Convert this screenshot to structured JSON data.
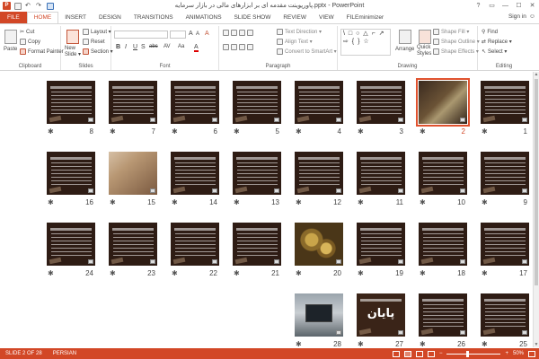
{
  "app": {
    "title": "پاورپوینت مقدمه ای بر ابزارهای مالی در بازار سرمایه.pptx - PowerPoint",
    "logo_letter": "P",
    "accent_color": "#d24726",
    "sign_in": "Sign in",
    "window_controls": [
      "?",
      "▭",
      "—",
      "☐",
      "✕"
    ]
  },
  "tabs": [
    {
      "label": "FILE",
      "key": "file"
    },
    {
      "label": "HOME",
      "key": "home",
      "active": true
    },
    {
      "label": "INSERT",
      "key": "insert"
    },
    {
      "label": "DESIGN",
      "key": "design"
    },
    {
      "label": "TRANSITIONS",
      "key": "transitions"
    },
    {
      "label": "ANIMATIONS",
      "key": "animations"
    },
    {
      "label": "SLIDE SHOW",
      "key": "slideshow"
    },
    {
      "label": "REVIEW",
      "key": "review"
    },
    {
      "label": "VIEW",
      "key": "view"
    },
    {
      "label": "FILEminimizer",
      "key": "fileminimizer"
    }
  ],
  "ribbon": {
    "clipboard": {
      "label": "Clipboard",
      "paste": "Paste",
      "cut": "Cut",
      "copy": "Copy",
      "format_painter": "Format Painter"
    },
    "slides": {
      "label": "Slides",
      "new_slide": "New",
      "new_slide_2": "Slide ▾",
      "layout": "Layout ▾",
      "reset": "Reset",
      "section": "Section ▾"
    },
    "font": {
      "label": "Font",
      "size_up": "A",
      "size_down": "A",
      "clear": "A",
      "bold": "B",
      "italic": "I",
      "underline": "U",
      "strike": "S",
      "shadow": "abc",
      "spacing": "AV",
      "case": "Aa",
      "color": "A"
    },
    "paragraph": {
      "label": "Paragraph",
      "text_direction": "Text Direction ▾",
      "align_text": "Align Text ▾",
      "smartart": "Convert to SmartArt ▾"
    },
    "drawing": {
      "label": "Drawing",
      "shapes": "\\ □ ○ △ ⌐ ↗ ⇨ { } ☆",
      "arrange": "Arrange",
      "quick_styles_1": "Quick",
      "quick_styles_2": "Styles ▾",
      "shape_fill": "Shape Fill ▾",
      "shape_outline": "Shape Outline ▾",
      "shape_effects": "Shape Effects ▾"
    },
    "editing": {
      "label": "Editing",
      "find": "Find",
      "replace": "Replace ▾",
      "select": "Select ▾"
    }
  },
  "slides": [
    {
      "num": "1",
      "style": "text",
      "star": "✱"
    },
    {
      "num": "2",
      "style": "money",
      "selected": true,
      "star": "✱"
    },
    {
      "num": "3",
      "style": "text",
      "star": "✱"
    },
    {
      "num": "4",
      "style": "text",
      "star": "✱"
    },
    {
      "num": "5",
      "style": "text",
      "star": "✱"
    },
    {
      "num": "6",
      "style": "text",
      "star": "✱"
    },
    {
      "num": "7",
      "style": "text",
      "star": "✱"
    },
    {
      "num": "8",
      "style": "text",
      "star": "✱"
    },
    {
      "num": "9",
      "style": "text",
      "star": "✱"
    },
    {
      "num": "10",
      "style": "text",
      "star": "✱"
    },
    {
      "num": "11",
      "style": "text",
      "star": "✱"
    },
    {
      "num": "12",
      "style": "text",
      "star": "✱"
    },
    {
      "num": "13",
      "style": "text",
      "star": "✱"
    },
    {
      "num": "14",
      "style": "text",
      "star": "✱"
    },
    {
      "num": "15",
      "style": "hand",
      "star": "✱"
    },
    {
      "num": "16",
      "style": "text",
      "star": "✱"
    },
    {
      "num": "17",
      "style": "text",
      "star": "✱"
    },
    {
      "num": "18",
      "style": "text",
      "star": "✱"
    },
    {
      "num": "19",
      "style": "text",
      "star": "✱"
    },
    {
      "num": "20",
      "style": "coins",
      "star": "✱"
    },
    {
      "num": "21",
      "style": "text",
      "star": "✱"
    },
    {
      "num": "22",
      "style": "text",
      "star": "✱"
    },
    {
      "num": "23",
      "style": "text",
      "star": "✱"
    },
    {
      "num": "24",
      "style": "text",
      "star": "✱"
    },
    {
      "num": "25",
      "style": "text",
      "star": "✱"
    },
    {
      "num": "26",
      "style": "text",
      "star": "✱"
    },
    {
      "num": "27",
      "style": "final",
      "bigword": "پایان",
      "star": "✱"
    },
    {
      "num": "28",
      "style": "laptop",
      "star": "✱"
    }
  ],
  "status": {
    "slide_of": "SLIDE 2 OF 28",
    "language": "PERSIAN",
    "zoom": "50%",
    "zoom_minus": "−",
    "zoom_plus": "+"
  }
}
